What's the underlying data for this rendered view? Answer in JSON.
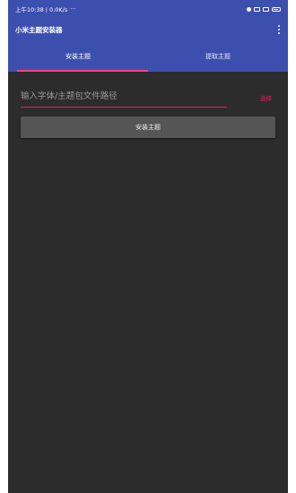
{
  "status_bar": {
    "time_text": "上午10:38 | 0.0K/s",
    "extra_icons": "···"
  },
  "app_bar": {
    "title": "小米主题安装器",
    "menu_icon": "more-vert-icon"
  },
  "tabs": [
    {
      "label": "安装主题",
      "active": true
    },
    {
      "label": "提取主题",
      "active": false
    }
  ],
  "form": {
    "path_input": {
      "placeholder": "输入字体/主题包文件路径",
      "value": ""
    },
    "select_label": "选择",
    "install_button_label": "安装主题"
  },
  "colors": {
    "primary": "#3d4fae",
    "accent": "#e91e63",
    "background": "#2c2c2c",
    "button": "#555555"
  }
}
